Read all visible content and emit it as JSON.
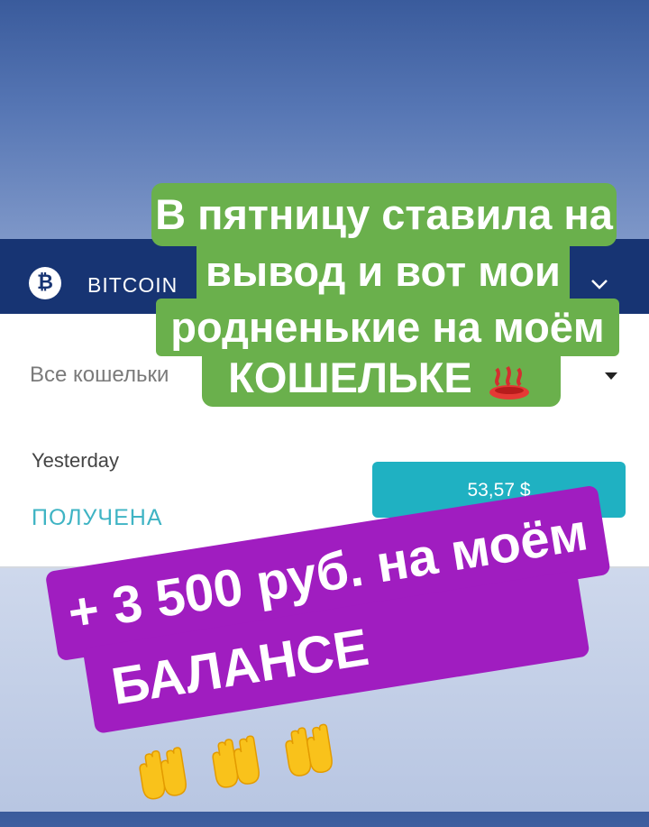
{
  "app": {
    "coin_symbol": "₿",
    "coin_label": "BITCOIN",
    "wallet_filter": "Все кошельки"
  },
  "transaction": {
    "date": "Yesterday",
    "status": "ПОЛУЧЕНА",
    "amount": "53,57 $"
  },
  "overlay_green": {
    "line1": "В пятницу ставила на",
    "line2": "вывод и вот мои",
    "line3": "родненькие на моём",
    "line4_text": "КОШЕЛЬКЕ",
    "line4_suffix": "!!!",
    "emoji": "hot-springs-icon"
  },
  "overlay_purple": {
    "line1": "+ 3 500 руб. на моём",
    "line2": "БАЛАНСЕ",
    "emoji": "raising-hands-icon"
  },
  "colors": {
    "app_bar": "#173473",
    "accent_teal": "#1fb1c2",
    "green_sticker": "#6ab04c",
    "purple_sticker": "#a01dc0"
  }
}
